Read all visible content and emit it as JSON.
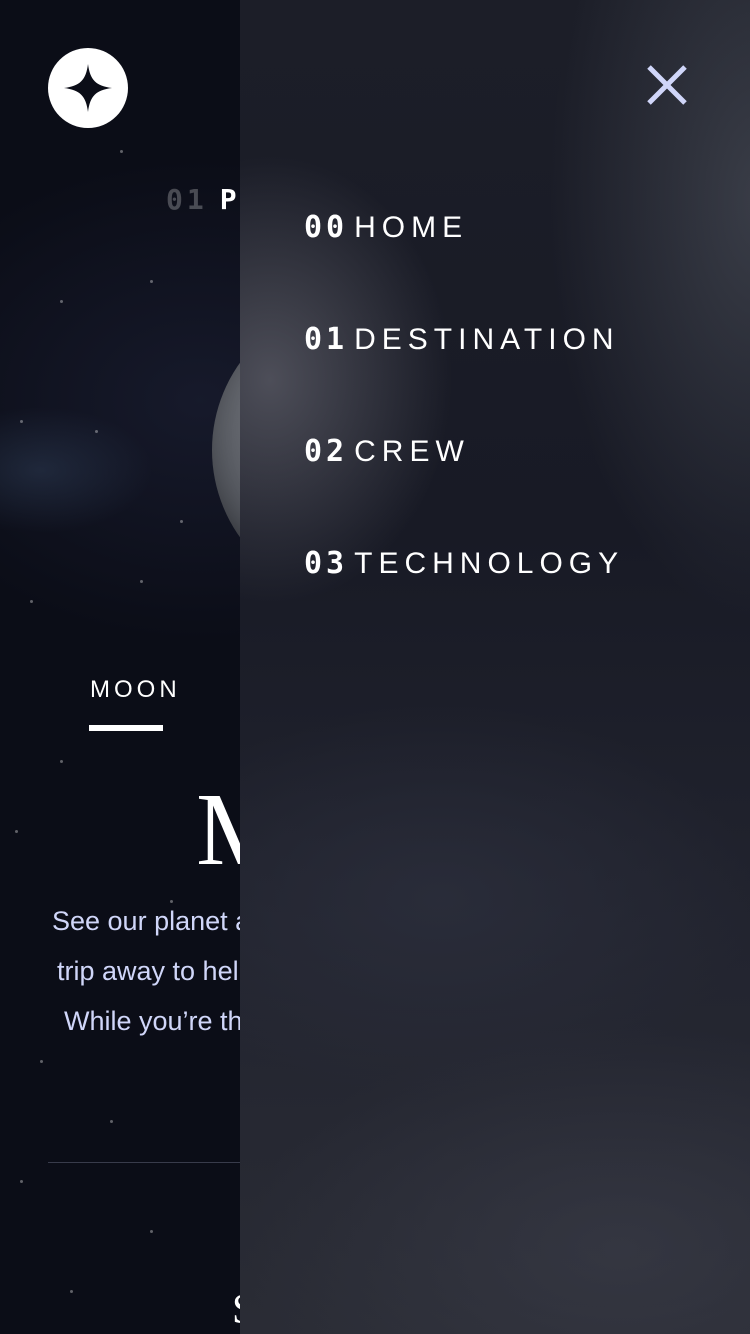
{
  "header": {
    "logo_icon": "star-logo-icon",
    "close_icon": "close-icon"
  },
  "page": {
    "heading_number": "01",
    "heading_text": "PI"
  },
  "destination": {
    "tab_label": "MOON",
    "name": "M",
    "description_lines": [
      "See our planet as y",
      "trip away to help r",
      "While you’re there"
    ],
    "bottom_fragment": "S"
  },
  "nav": {
    "items": [
      {
        "number": "00",
        "label": "HOME"
      },
      {
        "number": "01",
        "label": "DESTINATION"
      },
      {
        "number": "02",
        "label": "CREW"
      },
      {
        "number": "03",
        "label": "TECHNOLOGY"
      }
    ]
  },
  "colors": {
    "background": "#0b0d17",
    "accent_text": "#d0d6f9",
    "close_icon": "#d0d6f9"
  }
}
